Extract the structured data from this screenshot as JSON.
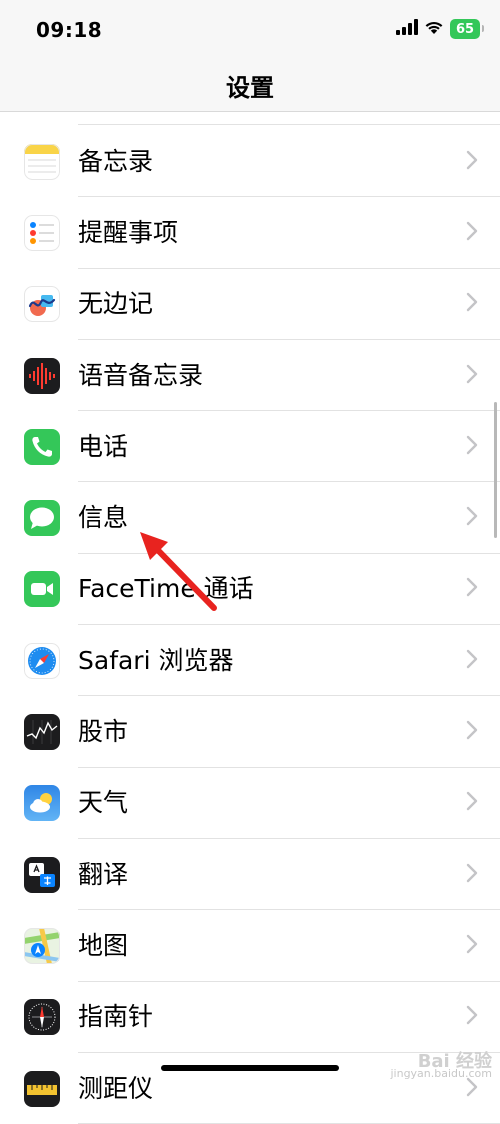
{
  "status_bar": {
    "time": "09:18",
    "battery": "65",
    "battery_color": "#34c759"
  },
  "nav": {
    "title": "设置"
  },
  "settings_items": [
    {
      "label": "备忘录",
      "icon": "notes-icon"
    },
    {
      "label": "提醒事项",
      "icon": "reminders-icon"
    },
    {
      "label": "无边记",
      "icon": "freeform-icon"
    },
    {
      "label": "语音备忘录",
      "icon": "voice-memos-icon"
    },
    {
      "label": "电话",
      "icon": "phone-icon"
    },
    {
      "label": "信息",
      "icon": "messages-icon"
    },
    {
      "label": "FaceTime 通话",
      "icon": "facetime-icon"
    },
    {
      "label": "Safari 浏览器",
      "icon": "safari-icon"
    },
    {
      "label": "股市",
      "icon": "stocks-icon"
    },
    {
      "label": "天气",
      "icon": "weather-icon"
    },
    {
      "label": "翻译",
      "icon": "translate-icon"
    },
    {
      "label": "地图",
      "icon": "maps-icon"
    },
    {
      "label": "指南针",
      "icon": "compass-icon"
    },
    {
      "label": "测距仪",
      "icon": "measure-icon"
    }
  ],
  "colors": {
    "annotation_arrow": "#e8231f",
    "chevron": "#c4c4c7",
    "separator": "#e2e2e2",
    "nav_background": "#f7f7f7"
  },
  "watermark": {
    "main": "Bai 经验",
    "sub": "jingyan.baidu.com"
  }
}
